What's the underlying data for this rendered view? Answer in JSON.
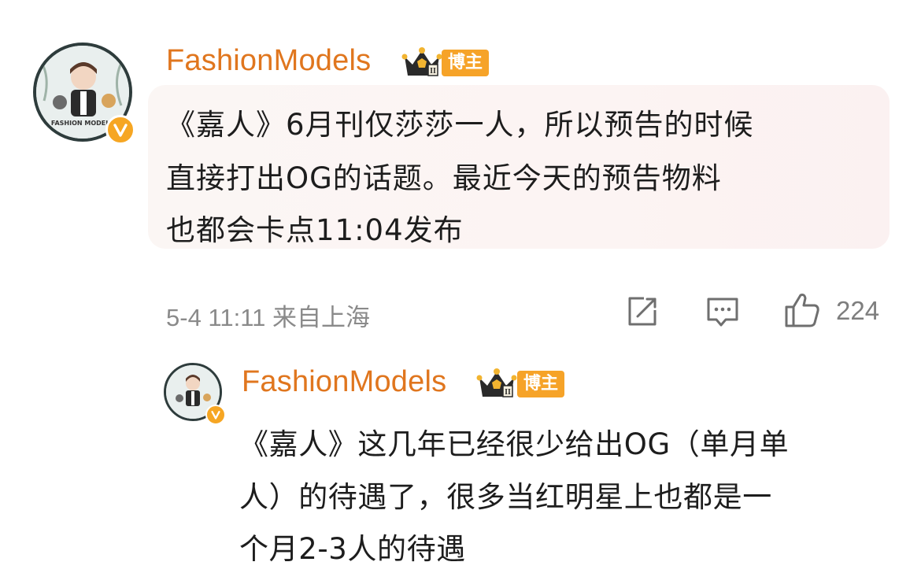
{
  "post": {
    "username": "FashionModels",
    "role_tag": "博主",
    "avatar_text": "FASHION MODELS",
    "content_lines": [
      "《嘉人》6月刊仅莎莎一人，所以预告的时候",
      "直接打出OG的话题。最近今天的预告物料",
      "也都会卡点11:04发布"
    ],
    "meta": "5-4 11:11 来自上海",
    "like_count": "224",
    "icons": [
      "share-icon",
      "comment-icon",
      "like-icon",
      "verified-icon",
      "crown-icon"
    ]
  },
  "reply": {
    "username": "FashionModels",
    "role_tag": "博主",
    "content_lines": [
      "《嘉人》这几年已经很少给出OG（单月单",
      "人）的待遇了，很多当红明星上也都是一",
      "个月2-3人的待遇"
    ]
  },
  "colors": {
    "username": "#e0761e",
    "tag_bg": "#f6a328",
    "verified": "#f6a623",
    "bubble_bg": "#fbf4f3",
    "meta_text": "#8a8a8a"
  }
}
